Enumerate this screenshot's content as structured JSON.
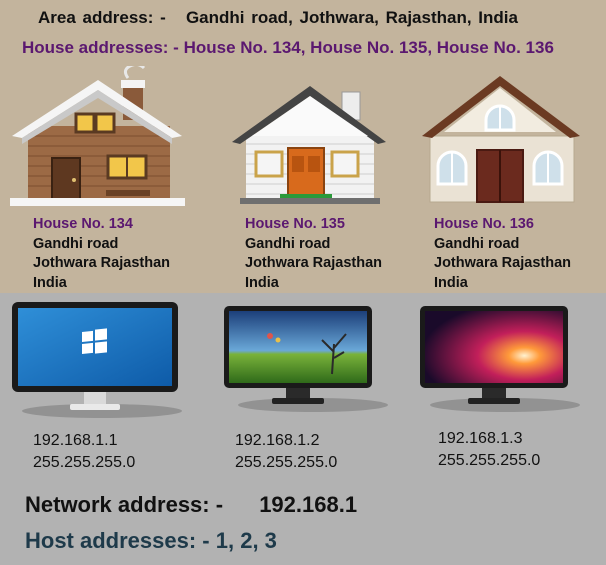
{
  "area": {
    "label": "Area address: -",
    "value": "Gandhi road, Jothwara, Rajasthan, India"
  },
  "house_addresses": "House No. 134, House No. 135, House No. 136",
  "house_addresses_label": "House addresses: -",
  "houses": [
    {
      "number": "House No. 134",
      "line1": "Gandhi road",
      "line2": "Jothwara Rajasthan",
      "line3": "India"
    },
    {
      "number": "House No. 135",
      "line1": "Gandhi road",
      "line2": "Jothwara Rajasthan",
      "line3": "India"
    },
    {
      "number": "House No. 136",
      "line1": "Gandhi road",
      "line2": "Jothwara Rajasthan",
      "line3": "India"
    }
  ],
  "computers": [
    {
      "ip": "192.168.1.1",
      "mask": "255.255.255.0"
    },
    {
      "ip": "192.168.1.2",
      "mask": "255.255.255.0"
    },
    {
      "ip": "192.168.1.3",
      "mask": "255.255.255.0"
    }
  ],
  "network": {
    "label": "Network address: -",
    "value": "192.168.1"
  },
  "host": {
    "label": "Host addresses: -",
    "value": "1, 2, 3"
  },
  "icons": [
    "wooden-house-icon",
    "white-house-icon",
    "stone-house-icon",
    "windows-monitor-icon",
    "landscape-monitor-icon",
    "sunburst-monitor-icon"
  ],
  "colors": {
    "top_bg": "#c3b49d",
    "bottom_bg": "#b2b2b2",
    "house_label": "#5b1870",
    "host_text": "#1e3a4a"
  }
}
